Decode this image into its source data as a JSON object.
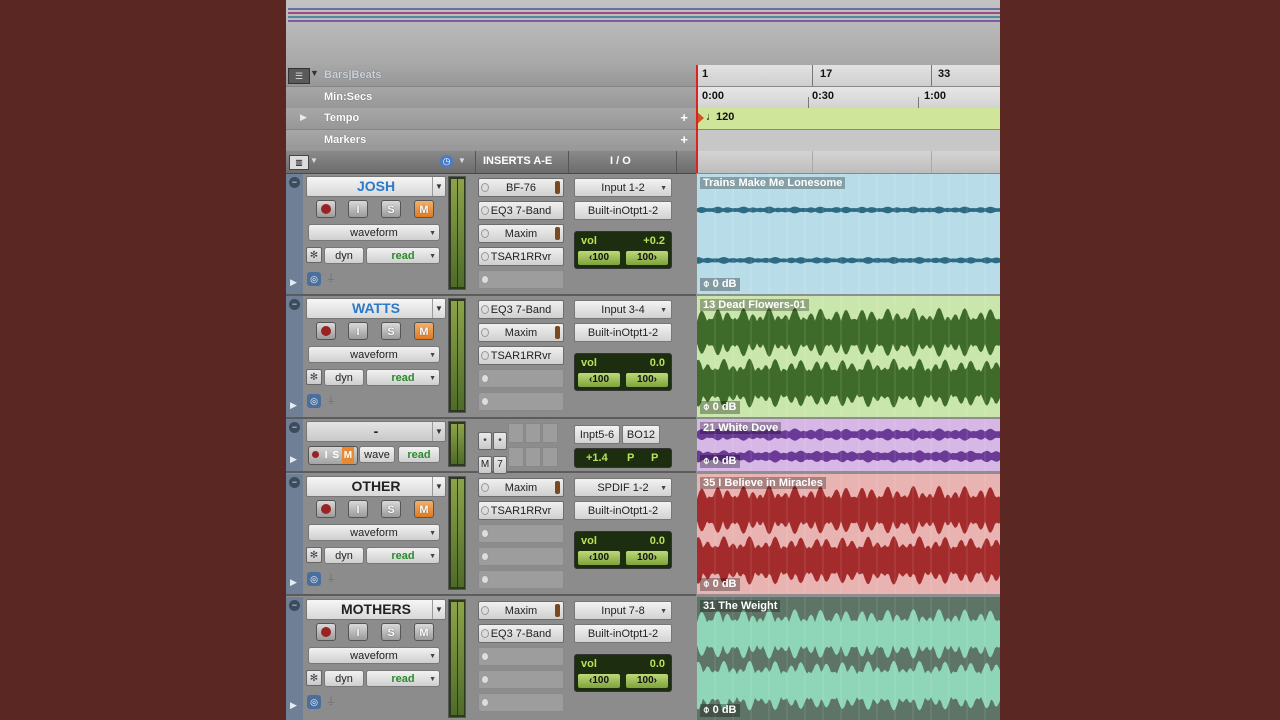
{
  "ruler": {
    "bars_label": "Bars|Beats",
    "minsecs_label": "Min:Secs",
    "tempo_label": "Tempo",
    "markers_label": "Markers",
    "bar_ticks": [
      "1",
      "17",
      "33"
    ],
    "time_ticks": [
      "0:00",
      "0:30",
      "1:00"
    ],
    "tempo_value": "120",
    "plus": "+"
  },
  "header": {
    "inserts": "INSERTS A-E",
    "io": "I / O"
  },
  "buttons": {
    "input": "I",
    "solo": "S",
    "mute": "M"
  },
  "tracks": [
    {
      "name": "JOSH",
      "name_color": "#2b79c9",
      "view": "waveform",
      "auto_mode": "dyn",
      "auto_state": "read",
      "inserts": [
        "BF-76",
        "EQ3 7-Band",
        "Maxim",
        "TSAR1RRvr"
      ],
      "io_in": "Input 1-2",
      "io_out": "Built-inOtpt1-2",
      "vol_label": "vol",
      "vol_value": "+0.2",
      "pan_l": "100",
      "pan_r": "100",
      "clip_name": "Trains Make Me Lonesome",
      "clip_gain": "0 dB",
      "clip_bg": "#b9dde8",
      "wave_color": "#2d6a84",
      "mute_on": true
    },
    {
      "name": "WATTS",
      "name_color": "#2b79c9",
      "view": "waveform",
      "auto_mode": "dyn",
      "auto_state": "read",
      "inserts": [
        "EQ3 7-Band",
        "Maxim",
        "TSAR1RRvr"
      ],
      "io_in": "Input 3-4",
      "io_out": "Built-inOtpt1-2",
      "vol_label": "vol",
      "vol_value": "0.0",
      "pan_l": "100",
      "pan_r": "100",
      "clip_name": "13 Dead Flowers-01",
      "clip_gain": "0 dB",
      "clip_bg": "#c9e6ad",
      "wave_color": "#3f6b2a",
      "mute_on": true
    },
    {
      "name": "-",
      "name_color": "#222222",
      "view": "wave",
      "auto_state": "read",
      "mini_inserts": [
        "M",
        "7"
      ],
      "io_in": "Inpt5-6",
      "io_out": "BO12",
      "vol_value": "+1.4",
      "pan_l": "P",
      "pan_r": "P",
      "clip_name": "21 White Dove",
      "clip_gain": "0 dB",
      "clip_bg": "#d6b7e6",
      "wave_color": "#6a3a96",
      "mute_on": true
    },
    {
      "name": "OTHER",
      "name_color": "#222222",
      "view": "waveform",
      "auto_mode": "dyn",
      "auto_state": "read",
      "inserts": [
        "Maxim",
        "TSAR1RRvr"
      ],
      "io_in": "SPDIF 1-2",
      "io_out": "Built-inOtpt1-2",
      "vol_label": "vol",
      "vol_value": "0.0",
      "pan_l": "100",
      "pan_r": "100",
      "clip_name": "35 I Believe in Miracles",
      "clip_gain": "0 dB",
      "clip_bg": "#e8b3b1",
      "wave_color": "#a32b2b",
      "mute_on": true
    },
    {
      "name": "MOTHERS",
      "name_color": "#222222",
      "view": "waveform",
      "auto_mode": "dyn",
      "auto_state": "read",
      "inserts": [
        "Maxim",
        "EQ3 7-Band"
      ],
      "io_in": "Input 7-8",
      "io_out": "Built-inOtpt1-2",
      "vol_label": "vol",
      "vol_value": "0.0",
      "pan_l": "100",
      "pan_r": "100",
      "clip_name": "31 The Weight",
      "clip_gain": "0 dB",
      "clip_bg": "#5d7467",
      "wave_color": "#8fd6b8",
      "mute_on": false
    }
  ],
  "colors": {
    "background": "#5b2723",
    "selection": "#6e7f96",
    "tempo_bar": "#cfe59a"
  }
}
